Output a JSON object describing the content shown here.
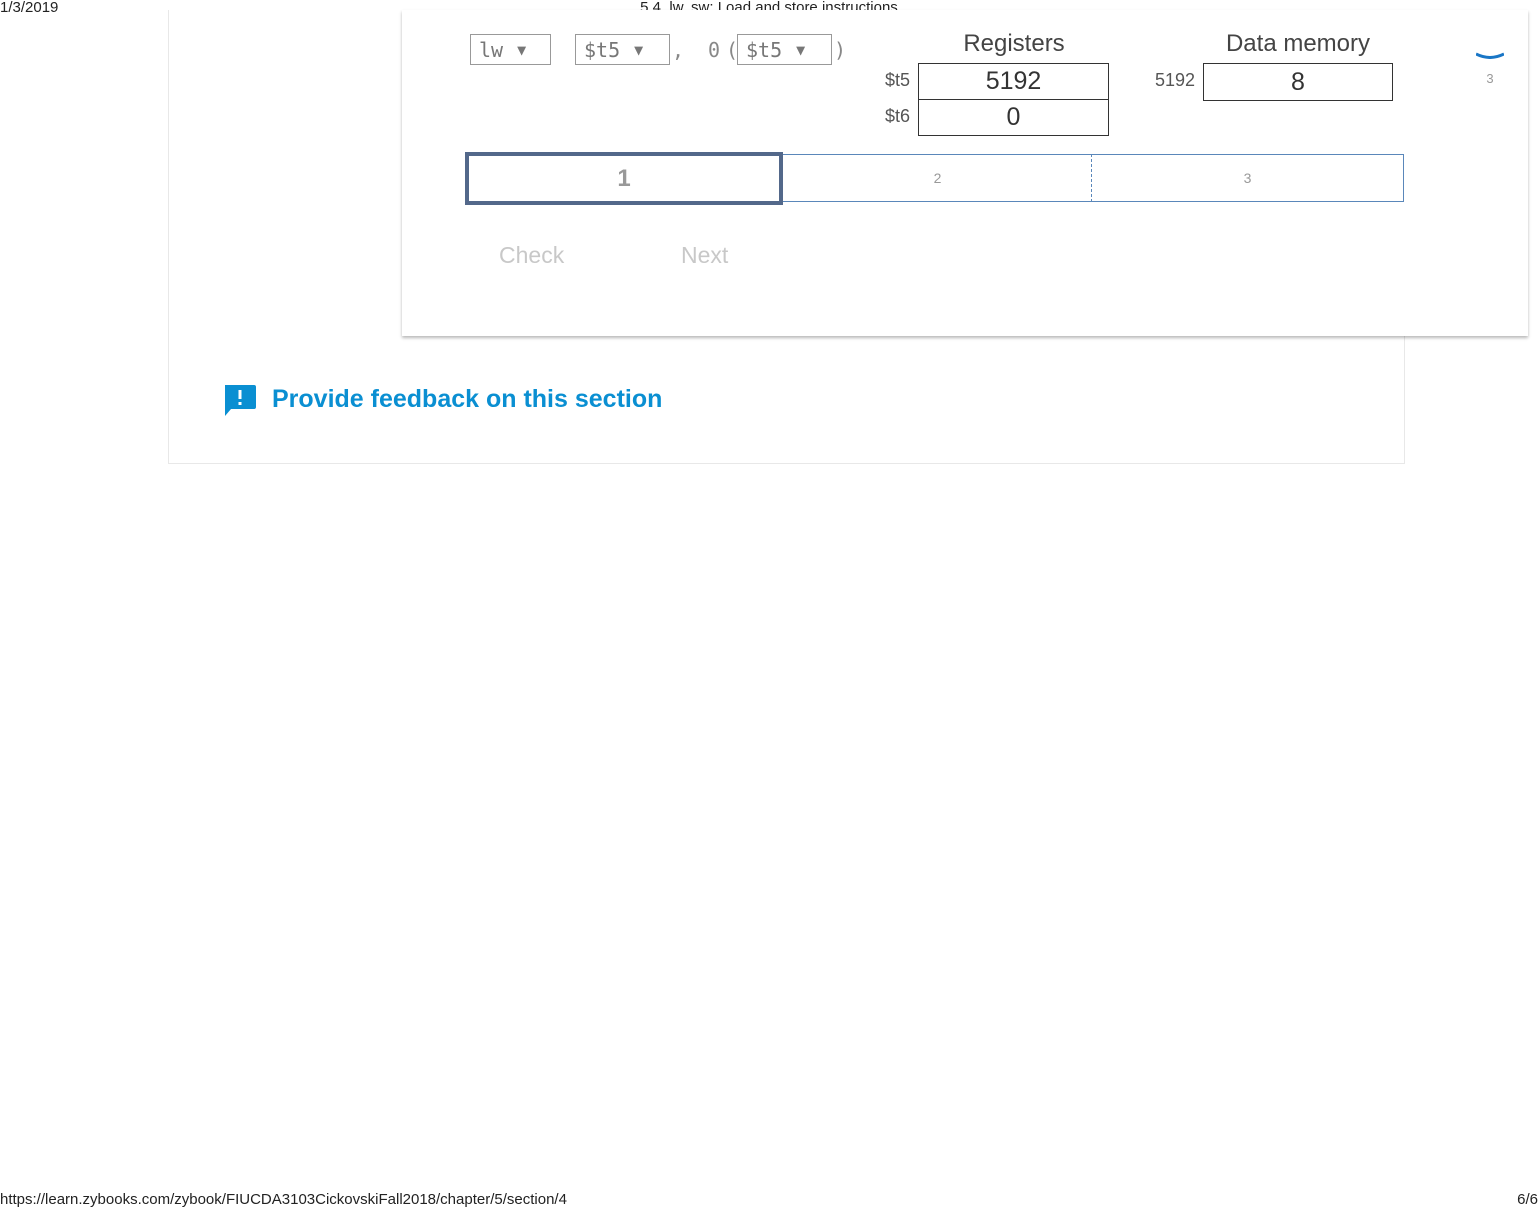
{
  "print_header": {
    "date": "1/3/2019",
    "title": "5.4. lw, sw: Load and store instructions"
  },
  "print_footer": {
    "url": "https://learn.zybooks.com/zybook/FIUCDA3103CickovskiFall2018/chapter/5/section/4",
    "page": "6/6"
  },
  "activity": {
    "instruction": {
      "opcode": "lw",
      "dest_register": "$t5",
      "comma": ",",
      "offset": "0",
      "open_paren": "(",
      "base_register": "$t5",
      "close_paren": ")",
      "caret": "▼"
    },
    "registers": {
      "heading": "Registers",
      "rows": [
        {
          "name": "$t5",
          "value": "5192"
        },
        {
          "name": "$t6",
          "value": "0"
        }
      ]
    },
    "memory": {
      "heading": "Data memory",
      "rows": [
        {
          "address": "5192",
          "value": "8"
        }
      ]
    },
    "progress": {
      "steps": [
        "1",
        "2",
        "3"
      ],
      "current": 1
    },
    "buttons": {
      "check": "Check",
      "next": "Next"
    },
    "side_indicator": "3"
  },
  "feedback": {
    "label": "Provide feedback on this section"
  },
  "colors": {
    "accent": "#0a8fd2",
    "progress_active_border": "#53688a",
    "progress_border": "#5a87ba"
  }
}
